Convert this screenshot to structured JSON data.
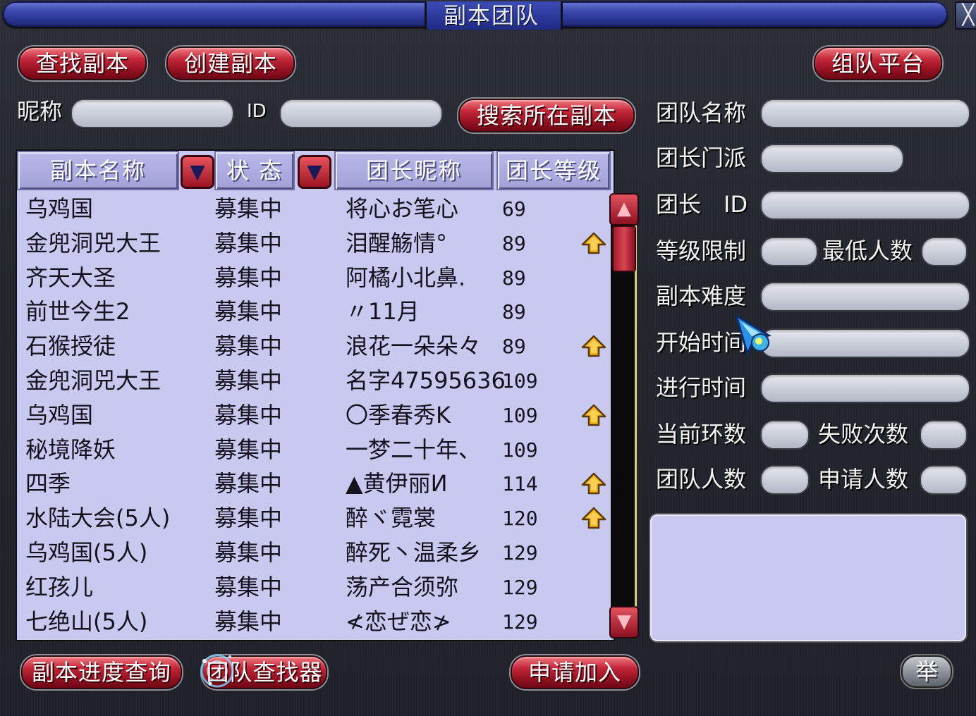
{
  "window": {
    "title": "副本团队",
    "close_label": "╳"
  },
  "toolbar": {
    "find_instance": "查找副本",
    "create_instance": "创建副本",
    "team_platform": "组队平台"
  },
  "search": {
    "nickname_label": "昵称",
    "id_label": "ID",
    "nickname_value": "",
    "id_value": "",
    "search_button": "搜索所在副本"
  },
  "table": {
    "headers": [
      "副本名称",
      "状 态",
      "团长昵称",
      "团长等级"
    ],
    "sort_icon": "▼",
    "rows": [
      {
        "name": "乌鸡国",
        "status": "募集中",
        "leader": "将心お笔心",
        "level": "69",
        "marked": false
      },
      {
        "name": "金兜洞兕大王",
        "status": "募集中",
        "leader": "泪醒觞情°",
        "level": "89",
        "marked": true
      },
      {
        "name": "齐天大圣",
        "status": "募集中",
        "leader": "阿橘小北鼻.",
        "level": "89",
        "marked": false
      },
      {
        "name": "前世今生2",
        "status": "募集中",
        "leader": "〃11月",
        "level": "89",
        "marked": false
      },
      {
        "name": "石猴授徒",
        "status": "募集中",
        "leader": "浪花一朵朵々",
        "level": "89",
        "marked": true
      },
      {
        "name": "金兜洞兕大王",
        "status": "募集中",
        "leader": "名字47595636",
        "level": "109",
        "marked": false
      },
      {
        "name": "乌鸡国",
        "status": "募集中",
        "leader": "〇季春秀K",
        "level": "109",
        "marked": true
      },
      {
        "name": "秘境降妖",
        "status": "募集中",
        "leader": "一梦二十年、",
        "level": "109",
        "marked": false
      },
      {
        "name": "四季",
        "status": "募集中",
        "leader": "▲黄伊丽И",
        "level": "114",
        "marked": true
      },
      {
        "name": "水陆大会(5人)",
        "status": "募集中",
        "leader": "醉ヾ霓裳",
        "level": "120",
        "marked": true
      },
      {
        "name": "乌鸡国(5人)",
        "status": "募集中",
        "leader": "醉死丶温柔乡",
        "level": "129",
        "marked": false
      },
      {
        "name": "红孩儿",
        "status": "募集中",
        "leader": "荡产合须弥",
        "level": "129",
        "marked": false
      },
      {
        "name": "七绝山(5人)",
        "status": "募集中",
        "leader": "≮恋ぜ恋≯",
        "level": "129",
        "marked": false
      }
    ]
  },
  "details": {
    "team_name": "团队名称",
    "leader_school": "团长门派",
    "leader_id": "团长　ID",
    "level_limit": "等级限制",
    "min_members": "最低人数",
    "difficulty": "副本难度",
    "start_time": "开始时间",
    "elapsed_time": "进行时间",
    "current_round": "当前环数",
    "fail_count": "失败次数",
    "team_size": "团队人数",
    "applicants": "申请人数"
  },
  "bottom": {
    "progress_query": "副本进度查询",
    "team_finder": "团队查找器",
    "apply_join": "申请加入",
    "report": "举"
  },
  "colors": {
    "accent_red": "#c4283a",
    "panel_lavender": "#c9c8ef",
    "title_blue": "#3e4bb0",
    "marker_gold": "#f2b21c"
  }
}
